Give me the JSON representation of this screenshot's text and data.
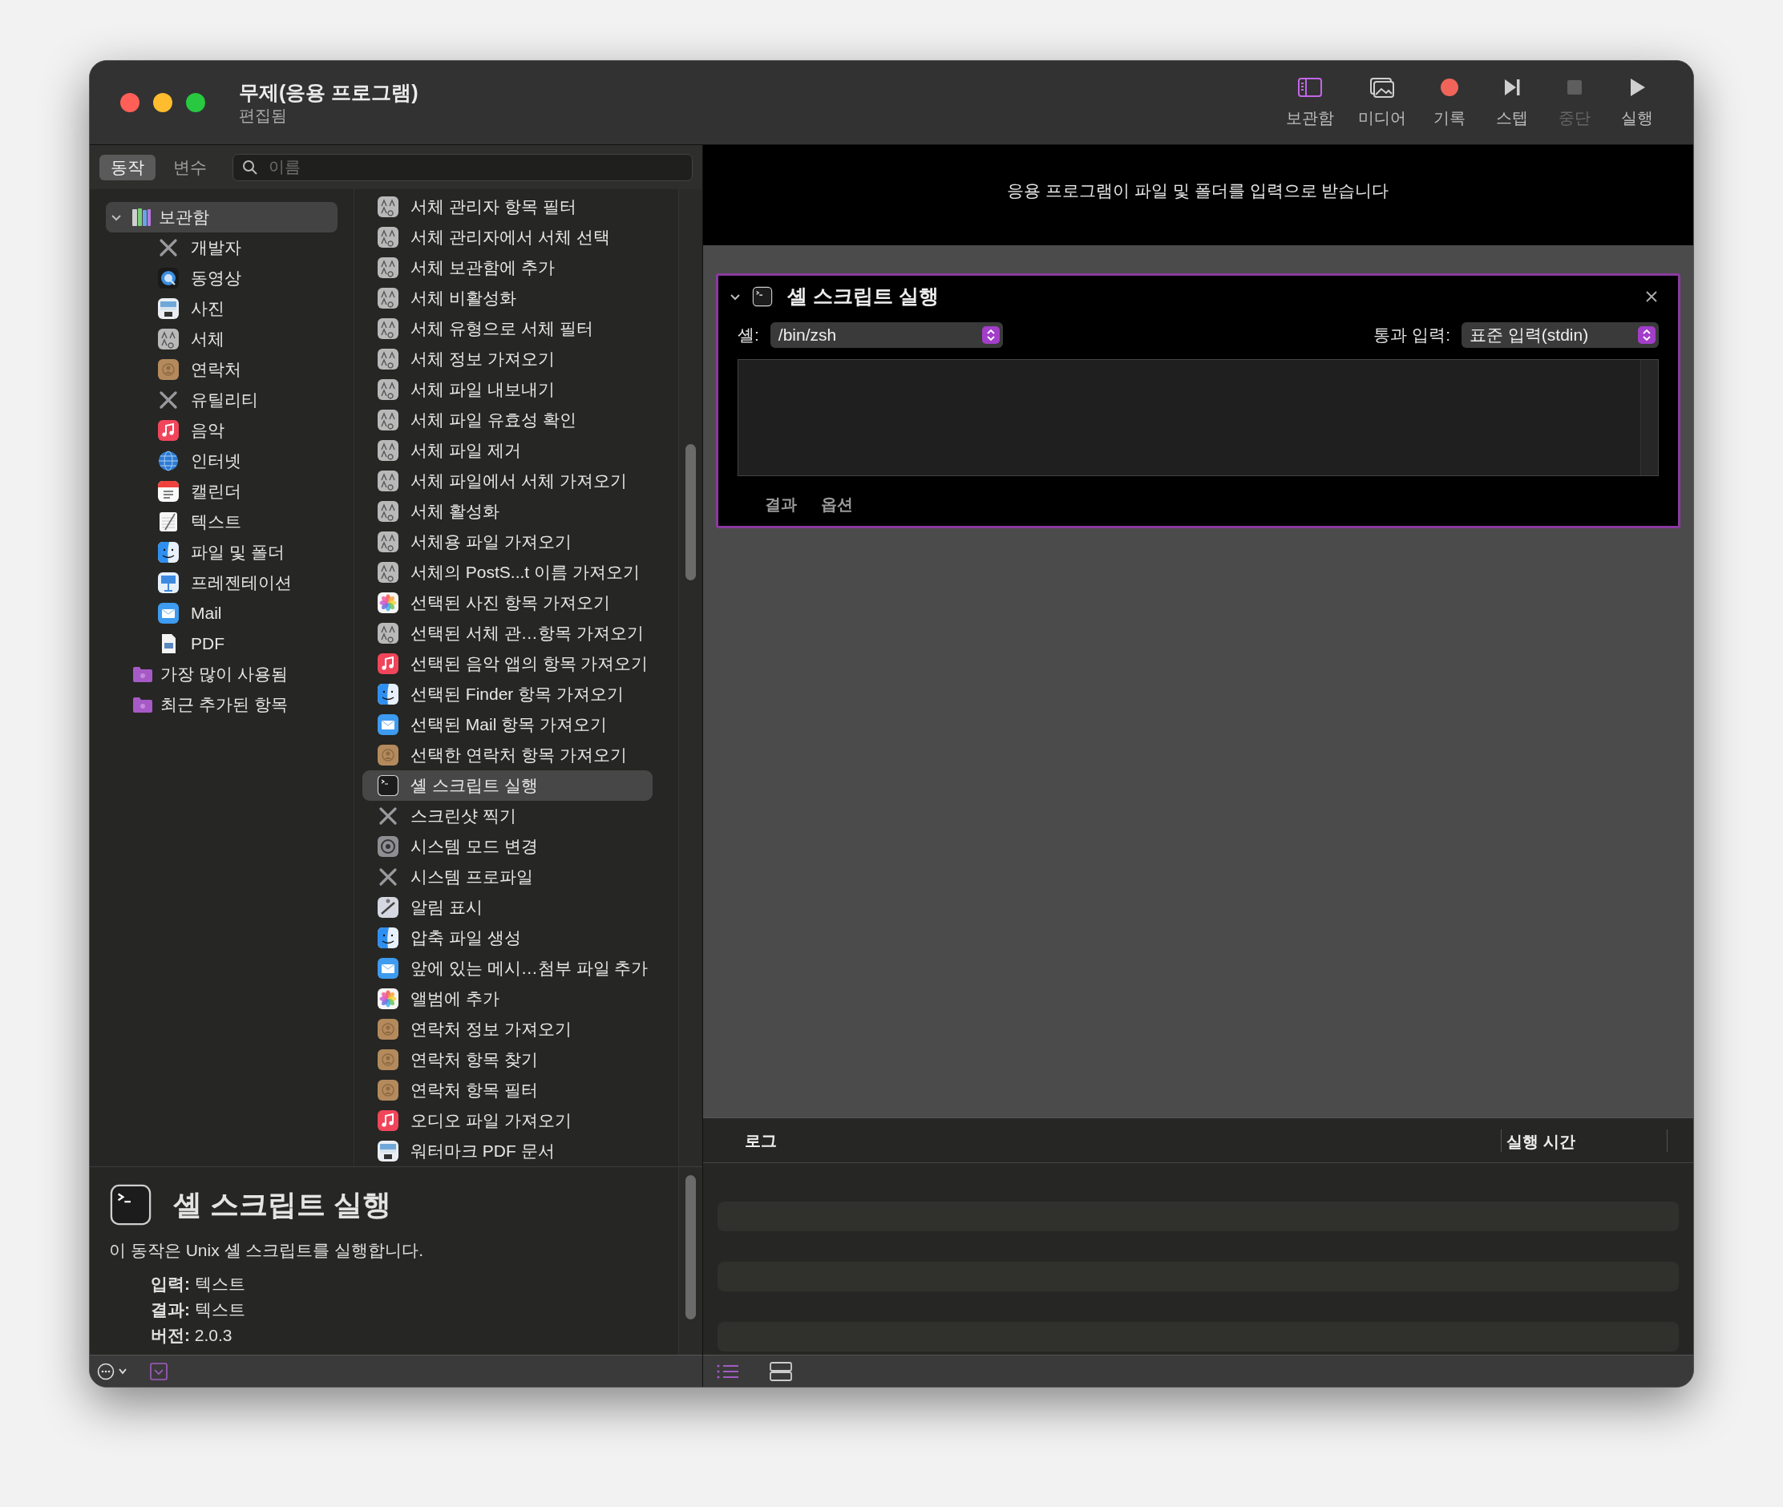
{
  "window": {
    "title": "무제(응용 프로그램)",
    "subtitle": "편집됨"
  },
  "toolbar": [
    {
      "label": "보관함",
      "kind": "library",
      "on": true,
      "disabled": false
    },
    {
      "label": "미디어",
      "kind": "media",
      "on": false,
      "disabled": false
    },
    {
      "label": "기록",
      "kind": "record",
      "on": false,
      "disabled": false
    },
    {
      "label": "스텝",
      "kind": "step",
      "on": false,
      "disabled": false
    },
    {
      "label": "중단",
      "kind": "stop",
      "on": false,
      "disabled": true
    },
    {
      "label": "실행",
      "kind": "run",
      "on": false,
      "disabled": false
    }
  ],
  "tabs": [
    {
      "label": "동작",
      "selected": true
    },
    {
      "label": "변수",
      "selected": false
    }
  ],
  "search": {
    "placeholder": "이름"
  },
  "sidebar": {
    "items": [
      {
        "label": "보관함",
        "kind": "library",
        "expanded": true,
        "selected": true,
        "children": [
          {
            "label": "개발자",
            "kind": "tools"
          },
          {
            "label": "동영상",
            "kind": "quicktime"
          },
          {
            "label": "사진",
            "kind": "preview"
          },
          {
            "label": "서체",
            "kind": "font"
          },
          {
            "label": "연락처",
            "kind": "contacts"
          },
          {
            "label": "유틸리티",
            "kind": "tools"
          },
          {
            "label": "음악",
            "kind": "music"
          },
          {
            "label": "인터넷",
            "kind": "globe"
          },
          {
            "label": "캘린더",
            "kind": "calendar"
          },
          {
            "label": "텍스트",
            "kind": "textedit"
          },
          {
            "label": "파일 및 폴더",
            "kind": "finder"
          },
          {
            "label": "프레젠테이션",
            "kind": "keynote"
          },
          {
            "label": "Mail",
            "kind": "mail"
          },
          {
            "label": "PDF",
            "kind": "pdf"
          }
        ]
      },
      {
        "label": "가장 많이 사용됨",
        "kind": "folder",
        "selected": false
      },
      {
        "label": "최근 추가된 항목",
        "kind": "folder",
        "selected": false
      }
    ]
  },
  "actions": [
    {
      "label": "서체 관리자 항목 필터",
      "kind": "font",
      "selected": false
    },
    {
      "label": "서체 관리자에서 서체 선택",
      "kind": "font",
      "selected": false
    },
    {
      "label": "서체 보관함에 추가",
      "kind": "font",
      "selected": false
    },
    {
      "label": "서체 비활성화",
      "kind": "font",
      "selected": false
    },
    {
      "label": "서체 유형으로 서체 필터",
      "kind": "font",
      "selected": false
    },
    {
      "label": "서체 정보 가져오기",
      "kind": "font",
      "selected": false
    },
    {
      "label": "서체 파일 내보내기",
      "kind": "font",
      "selected": false
    },
    {
      "label": "서체 파일 유효성 확인",
      "kind": "font",
      "selected": false
    },
    {
      "label": "서체 파일 제거",
      "kind": "font",
      "selected": false
    },
    {
      "label": "서체 파일에서 서체 가져오기",
      "kind": "font",
      "selected": false
    },
    {
      "label": "서체 활성화",
      "kind": "font",
      "selected": false
    },
    {
      "label": "서체용 파일 가져오기",
      "kind": "font",
      "selected": false
    },
    {
      "label": "서체의 PostS...t 이름 가져오기",
      "kind": "font",
      "selected": false
    },
    {
      "label": "선택된 사진 항목 가져오기",
      "kind": "photos",
      "selected": false
    },
    {
      "label": "선택된 서체 관…항목 가져오기",
      "kind": "font",
      "selected": false
    },
    {
      "label": "선택된 음악 앱의 항목 가져오기",
      "kind": "music",
      "selected": false
    },
    {
      "label": "선택된 Finder 항목 가져오기",
      "kind": "finder",
      "selected": false
    },
    {
      "label": "선택된 Mail 항목 가져오기",
      "kind": "mail",
      "selected": false
    },
    {
      "label": "선택한 연락처 항목 가져오기",
      "kind": "contacts",
      "selected": false
    },
    {
      "label": "셸 스크립트 실행",
      "kind": "terminal",
      "selected": true
    },
    {
      "label": "스크린샷 찍기",
      "kind": "tools",
      "selected": false
    },
    {
      "label": "시스템 모드 변경",
      "kind": "settings",
      "selected": false
    },
    {
      "label": "시스템 프로파일",
      "kind": "tools",
      "selected": false
    },
    {
      "label": "알림 표시",
      "kind": "notify",
      "selected": false
    },
    {
      "label": "압축 파일 생성",
      "kind": "finder",
      "selected": false
    },
    {
      "label": "앞에 있는 메시…첨부 파일 추가",
      "kind": "mail",
      "selected": false
    },
    {
      "label": "앨범에 추가",
      "kind": "photos",
      "selected": false
    },
    {
      "label": "연락처 정보 가져오기",
      "kind": "contacts",
      "selected": false
    },
    {
      "label": "연락처 항목 찾기",
      "kind": "contacts",
      "selected": false
    },
    {
      "label": "연락처 항목 필터",
      "kind": "contacts",
      "selected": false
    },
    {
      "label": "오디오 파일 가져오기",
      "kind": "music",
      "selected": false
    },
    {
      "label": "워터마크 PDF 문서",
      "kind": "preview",
      "selected": false
    }
  ],
  "description": {
    "title": "셸 스크립트 실행",
    "text": "이 동작은 Unix 셸 스크립트를 실행합니다.",
    "details": [
      "**입력:** 텍스트",
      "**결과:** 텍스트",
      "**버전:** 2.0.3"
    ]
  },
  "workflow": {
    "header": "응용 프로그램이 파일 및 폴더를 입력으로 받습니다",
    "action": {
      "title": "셸 스크립트 실행",
      "expanded": true,
      "shell_label": "셸:",
      "shell": "/bin/zsh",
      "pass_input_label": "통과 입력:",
      "pass_input": "표준 입력(stdin)",
      "tabs": [
        "결과",
        "옵션"
      ]
    }
  },
  "log": {
    "columns": [
      "로그",
      "실행 시간"
    ]
  }
}
